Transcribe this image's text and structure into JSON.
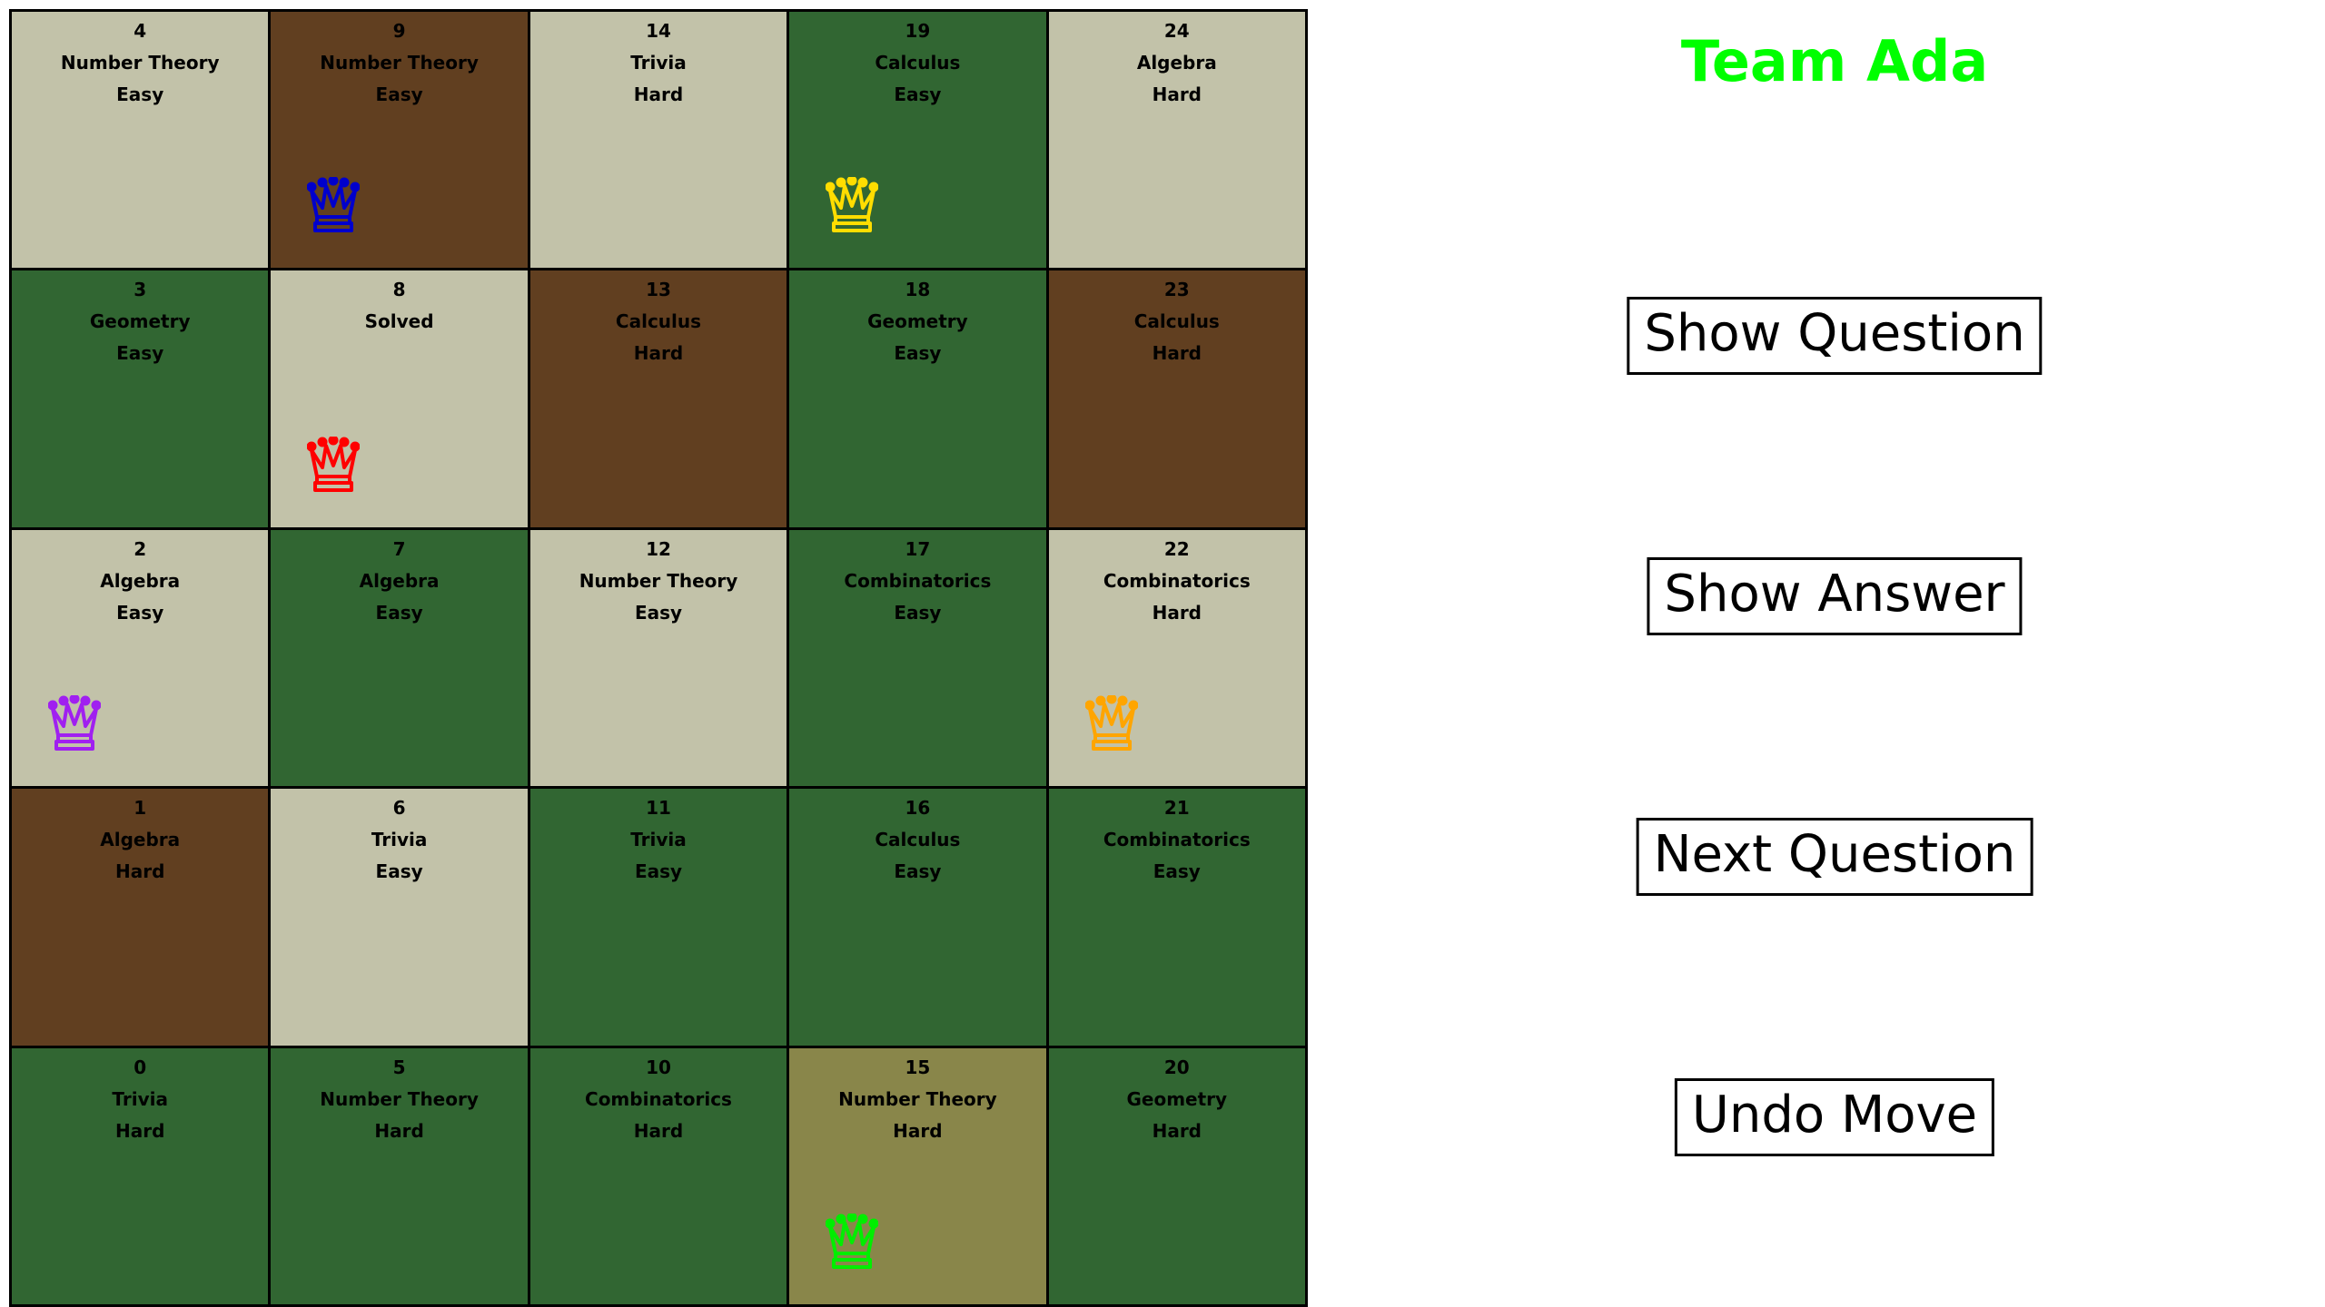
{
  "team": {
    "name": "Team Ada",
    "color": "#00ff00"
  },
  "colors": {
    "green": "#316632",
    "light": "#c2c2a9",
    "brown": "#613f20",
    "olive": "#89864a"
  },
  "board": {
    "rows": [
      [
        {
          "num": "4",
          "topic": "Number Theory",
          "level": "Easy",
          "color": "light"
        },
        {
          "num": "9",
          "topic": "Number Theory",
          "level": "Easy",
          "color": "brown",
          "queen": "#0000cc"
        },
        {
          "num": "14",
          "topic": "Trivia",
          "level": "Hard",
          "color": "light"
        },
        {
          "num": "19",
          "topic": "Calculus",
          "level": "Easy",
          "color": "green",
          "queen": "#ffdd00"
        },
        {
          "num": "24",
          "topic": "Algebra",
          "level": "Hard",
          "color": "light"
        }
      ],
      [
        {
          "num": "3",
          "topic": "Geometry",
          "level": "Easy",
          "color": "green"
        },
        {
          "num": "8",
          "topic": "Solved",
          "level": "",
          "color": "light",
          "queen": "#ff0000"
        },
        {
          "num": "13",
          "topic": "Calculus",
          "level": "Hard",
          "color": "brown"
        },
        {
          "num": "18",
          "topic": "Geometry",
          "level": "Easy",
          "color": "green"
        },
        {
          "num": "23",
          "topic": "Calculus",
          "level": "Hard",
          "color": "brown"
        }
      ],
      [
        {
          "num": "2",
          "topic": "Algebra",
          "level": "Easy",
          "color": "light",
          "queen": "#a020f0"
        },
        {
          "num": "7",
          "topic": "Algebra",
          "level": "Easy",
          "color": "green"
        },
        {
          "num": "12",
          "topic": "Number Theory",
          "level": "Easy",
          "color": "light"
        },
        {
          "num": "17",
          "topic": "Combinatorics",
          "level": "Easy",
          "color": "green"
        },
        {
          "num": "22",
          "topic": "Combinatorics",
          "level": "Hard",
          "color": "light",
          "queen": "#ffa500"
        }
      ],
      [
        {
          "num": "1",
          "topic": "Algebra",
          "level": "Hard",
          "color": "brown"
        },
        {
          "num": "6",
          "topic": "Trivia",
          "level": "Easy",
          "color": "light"
        },
        {
          "num": "11",
          "topic": "Trivia",
          "level": "Easy",
          "color": "green"
        },
        {
          "num": "16",
          "topic": "Calculus",
          "level": "Easy",
          "color": "green"
        },
        {
          "num": "21",
          "topic": "Combinatorics",
          "level": "Easy",
          "color": "green"
        }
      ],
      [
        {
          "num": "0",
          "topic": "Trivia",
          "level": "Hard",
          "color": "green"
        },
        {
          "num": "5",
          "topic": "Number Theory",
          "level": "Hard",
          "color": "green"
        },
        {
          "num": "10",
          "topic": "Combinatorics",
          "level": "Hard",
          "color": "green"
        },
        {
          "num": "15",
          "topic": "Number Theory",
          "level": "Hard",
          "color": "olive",
          "queen": "#00ee00"
        },
        {
          "num": "20",
          "topic": "Geometry",
          "level": "Hard",
          "color": "green"
        }
      ]
    ]
  },
  "buttons": {
    "show_question": "Show Question",
    "show_answer": "Show Answer",
    "next_question": "Next Question",
    "undo_move": "Undo Move"
  },
  "icons": {
    "queen": "queen-icon"
  }
}
